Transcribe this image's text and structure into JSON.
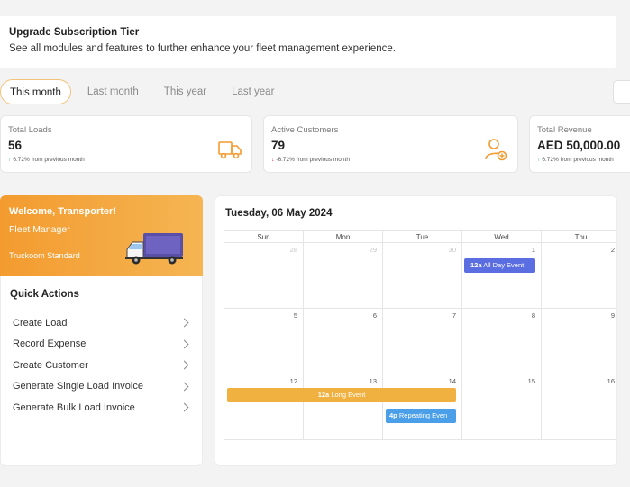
{
  "banner": {
    "title": "Upgrade Subscription Tier",
    "subtitle": "See all modules and features to further enhance your fleet management experience."
  },
  "tabs": [
    "This month",
    "Last month",
    "This year",
    "Last year"
  ],
  "stats": [
    {
      "label": "Total Loads",
      "value": "56",
      "change": "6.72% from previous month",
      "direction": "up",
      "icon": "truck-icon"
    },
    {
      "label": "Active Customers",
      "value": "79",
      "change": "-6.72% from previous month",
      "direction": "down",
      "icon": "user-add-icon"
    },
    {
      "label": "Total Revenue",
      "value": "AED 50,000.00",
      "change": "6.72% from previous month",
      "direction": "up",
      "icon": "revenue-icon"
    }
  ],
  "welcome": {
    "title": "Welcome, Transporter!",
    "role": "Fleet Manager",
    "plan": "Truckoom Standard"
  },
  "quick_actions": {
    "title": "Quick Actions",
    "items": [
      "Create Load",
      "Record Expense",
      "Create Customer",
      "Generate Single Load Invoice",
      "Generate Bulk Load Invoice"
    ]
  },
  "calendar": {
    "title": "Tuesday, 06 May 2024",
    "weekdays": [
      "Sun",
      "Mon",
      "Tue",
      "Wed",
      "Thu"
    ],
    "weeks": [
      [
        {
          "d": "28",
          "m": true
        },
        {
          "d": "29",
          "m": true
        },
        {
          "d": "30",
          "m": true
        },
        {
          "d": "1",
          "m": false
        },
        {
          "d": "2",
          "m": false
        }
      ],
      [
        {
          "d": "5",
          "m": false
        },
        {
          "d": "6",
          "m": false
        },
        {
          "d": "7",
          "m": false
        },
        {
          "d": "8",
          "m": false
        },
        {
          "d": "9",
          "m": false
        }
      ],
      [
        {
          "d": "12",
          "m": false
        },
        {
          "d": "13",
          "m": false
        },
        {
          "d": "14",
          "m": false
        },
        {
          "d": "15",
          "m": false
        },
        {
          "d": "16",
          "m": false
        }
      ]
    ],
    "events": {
      "all_day": {
        "time": "12a",
        "label": "All Day Event",
        "color": "#5b6ee1"
      },
      "long": {
        "time": "12a",
        "label": "Long Event",
        "color": "#f0b140"
      },
      "repeating": {
        "time": "4p",
        "label": "Repeating Even",
        "color": "#4a9fe8"
      }
    }
  },
  "colors": {
    "accent": "#f39b2f",
    "up": "#2db56a",
    "down": "#e04545"
  }
}
